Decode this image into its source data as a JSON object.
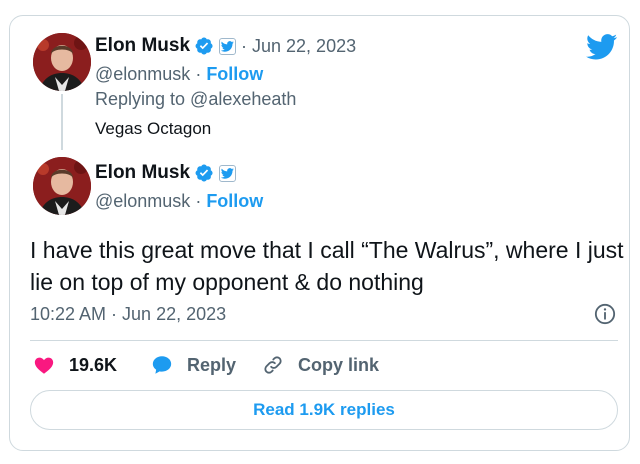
{
  "parent_tweet": {
    "author_name": "Elon Musk",
    "date": "· Jun 22, 2023",
    "handle": "@elonmusk",
    "separator": " · ",
    "follow_label": "Follow",
    "replying_to": "Replying to @alexeheath",
    "text": "Vegas Octagon"
  },
  "main_tweet": {
    "author_name": "Elon Musk",
    "handle": "@elonmusk",
    "separator": " · ",
    "follow_label": "Follow",
    "text": "I have this great move that I call “The Walrus”, where I just lie on top of my opponent & do nothing",
    "timestamp": "10:22 AM · Jun 22, 2023"
  },
  "actions": {
    "likes": "19.6K",
    "reply_label": "Reply",
    "copy_link_label": "Copy link"
  },
  "read_replies_label": "Read 1.9K replies",
  "icons": {
    "logo": "twitter-bird-icon",
    "verified": "verified-badge-icon",
    "affiliate": "affiliate-badge-icon",
    "info": "info-icon",
    "heart": "heart-icon",
    "reply": "reply-bubble-icon",
    "link": "link-icon"
  },
  "colors": {
    "accent": "#1d9bf0",
    "heart": "#f91880",
    "text": "#0f1419",
    "muted": "#536471",
    "border": "#cfd9de"
  }
}
